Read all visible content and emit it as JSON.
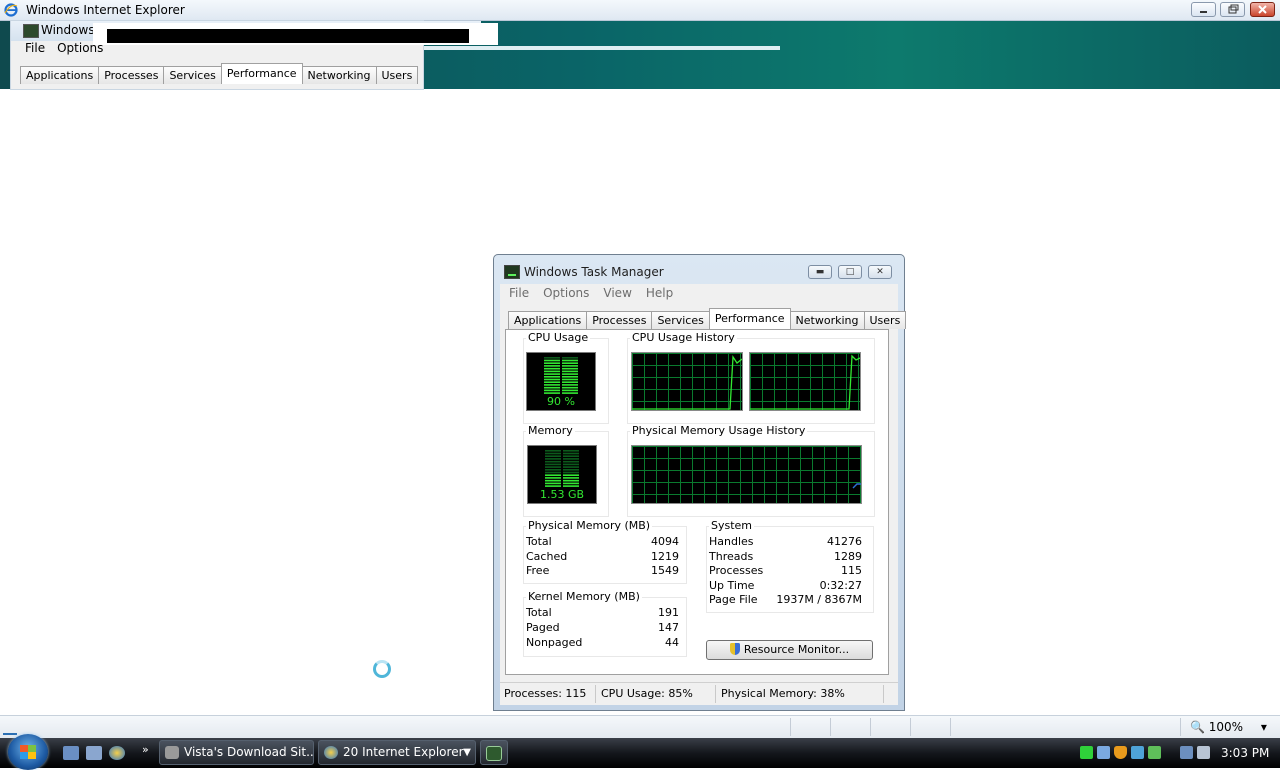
{
  "browser": {
    "title": "Windows Internet Explorer",
    "zoom": "100%"
  },
  "ghost_window": {
    "title": "Windows Task Manager",
    "menu": [
      "File",
      "Options"
    ],
    "tabs": [
      "Applications",
      "Processes",
      "Services",
      "Performance",
      "Networking",
      "Users"
    ]
  },
  "task_manager": {
    "title": "Windows Task Manager",
    "menu": [
      "File",
      "Options",
      "View",
      "Help"
    ],
    "tabs": [
      "Applications",
      "Processes",
      "Services",
      "Performance",
      "Networking",
      "Users"
    ],
    "active_tab": "Performance",
    "cpu_usage": {
      "label": "CPU Usage",
      "value": "90 %",
      "fill": 0.9
    },
    "cpu_history_label": "CPU Usage History",
    "memory": {
      "label": "Memory",
      "value": "1.53 GB",
      "fill": 0.38
    },
    "memory_history_label": "Physical Memory Usage History",
    "physical_memory": {
      "heading": "Physical Memory (MB)",
      "rows": [
        {
          "key": "Total",
          "value": "4094"
        },
        {
          "key": "Cached",
          "value": "1219"
        },
        {
          "key": "Free",
          "value": "1549"
        }
      ]
    },
    "kernel_memory": {
      "heading": "Kernel Memory (MB)",
      "rows": [
        {
          "key": "Total",
          "value": "191"
        },
        {
          "key": "Paged",
          "value": "147"
        },
        {
          "key": "Nonpaged",
          "value": "44"
        }
      ]
    },
    "system": {
      "heading": "System",
      "rows": [
        {
          "key": "Handles",
          "value": "41276"
        },
        {
          "key": "Threads",
          "value": "1289"
        },
        {
          "key": "Processes",
          "value": "115"
        },
        {
          "key": "Up Time",
          "value": "0:32:27"
        },
        {
          "key": "Page File",
          "value": "1937M / 8367M"
        }
      ]
    },
    "resource_monitor_button": "Resource Monitor...",
    "status": {
      "processes": "Processes: 115",
      "cpu": "CPU Usage: 85%",
      "memory": "Physical Memory: 38%"
    }
  },
  "taskbar": {
    "buttons": [
      {
        "label": "Vista's Download Sit..."
      },
      {
        "label": "20 Internet Explorer"
      }
    ],
    "clock": "3:03 PM"
  },
  "colors": {
    "graph_grid": "#0a7a2e",
    "graph_line": "#32e832",
    "banner": "#0a6467"
  }
}
